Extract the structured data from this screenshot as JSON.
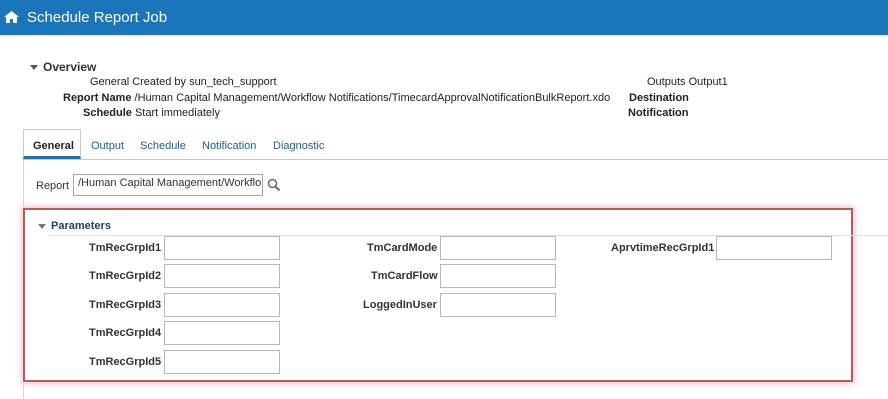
{
  "header": {
    "title": "Schedule Report Job",
    "icon": "home-icon"
  },
  "overview": {
    "label": "Overview",
    "general_label": "General",
    "general_value": "Created by sun_tech_support",
    "report_name_label": "Report Name",
    "report_name_value": "/Human Capital Management/Workflow Notifications/TimecardApprovalNotificationBulkReport.xdo",
    "schedule_label": "Schedule",
    "schedule_value": "Start immediately",
    "outputs_label": "Outputs",
    "outputs_value": "Output1",
    "destination_label": "Destination",
    "notification_label": "Notification"
  },
  "tabs": [
    "General",
    "Output",
    "Schedule",
    "Notification",
    "Diagnostic"
  ],
  "report": {
    "label": "Report",
    "value": "/Human Capital Management/Workflo"
  },
  "parameters": {
    "label": "Parameters",
    "col1": [
      "TmRecGrpId1",
      "TmRecGrpId2",
      "TmRecGrpId3",
      "TmRecGrpId4",
      "TmRecGrpId5"
    ],
    "col2": [
      "TmCardMode",
      "TmCardFlow",
      "LoggedInUser"
    ],
    "col3": [
      "AprvtimeRecGrpId1"
    ]
  },
  "colors": {
    "header_bg": "#1b75bb",
    "highlight_border": "#b95c52",
    "link": "#1b5d9c"
  }
}
